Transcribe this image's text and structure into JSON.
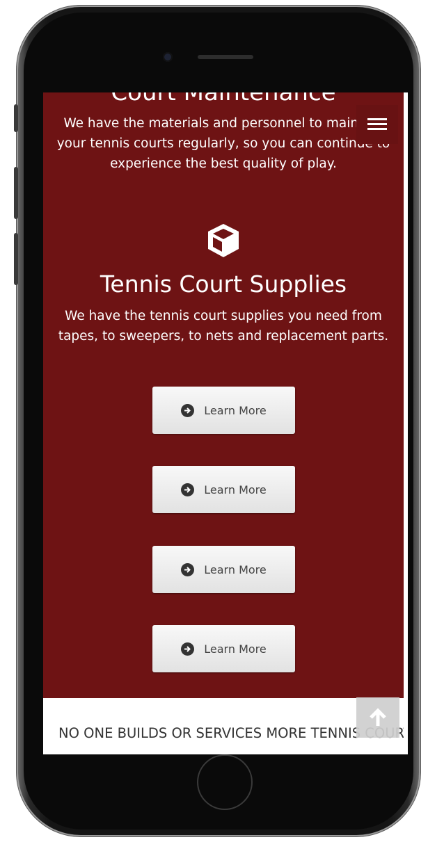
{
  "section_maintenance": {
    "title": "Court Maintenance",
    "description": "We have the materials and personnel to maintain your tennis courts regularly, so you can continue to experience the best quality of play."
  },
  "section_supplies": {
    "icon": "cube-icon",
    "title": "Tennis Court Supplies",
    "description": "We have the tennis court supplies you need from tapes, to sweepers, to nets and replacement parts."
  },
  "buttons": [
    {
      "label": "Learn More",
      "icon": "arrow-circle-right-icon"
    },
    {
      "label": "Learn More",
      "icon": "arrow-circle-right-icon"
    },
    {
      "label": "Learn More",
      "icon": "arrow-circle-right-icon"
    },
    {
      "label": "Learn More",
      "icon": "arrow-circle-right-icon"
    }
  ],
  "footer": {
    "tagline": "NO ONE BUILDS OR SERVICES MORE TENNIS COURTS THAN FAST-DRY"
  },
  "controls": {
    "menu_icon": "hamburger-menu-icon",
    "back_to_top_icon": "arrow-up-icon"
  },
  "colors": {
    "section_background": "#6e1314",
    "button_background": "#ececec",
    "button_text": "#444444",
    "phone_frame": "#151515"
  }
}
